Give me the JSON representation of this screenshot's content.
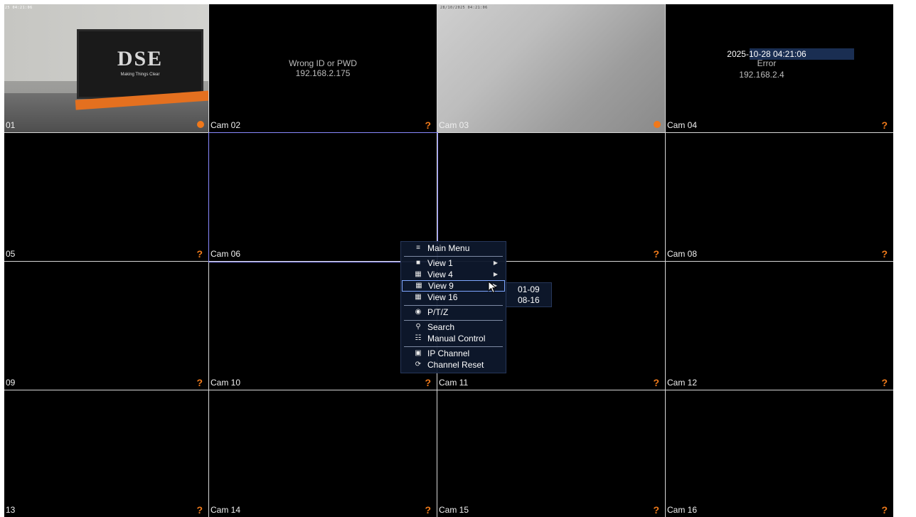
{
  "cells": [
    {
      "id": "c1",
      "label": "01",
      "status": "dot",
      "timestamp": "25 04:21:06"
    },
    {
      "id": "c2",
      "label": "Cam 02",
      "status": "?",
      "message": [
        "Wrong ID or PWD",
        "192.168.2.175"
      ]
    },
    {
      "id": "c3",
      "label": "Cam 03",
      "status": "dot",
      "timestamp": "28/10/2025 04:21:06"
    },
    {
      "id": "c4",
      "label": "Cam 04",
      "status": "?",
      "datetime": "2025-10-28 04:21:06",
      "message": [
        "Error",
        "192.168.2.4"
      ]
    },
    {
      "id": "c5",
      "label": "05",
      "status": "?"
    },
    {
      "id": "c6",
      "label": "Cam 06",
      "status": ""
    },
    {
      "id": "c7",
      "label": "",
      "status": "?"
    },
    {
      "id": "c8",
      "label": "Cam 08",
      "status": "?"
    },
    {
      "id": "c9",
      "label": "09",
      "status": "?"
    },
    {
      "id": "c10",
      "label": "Cam 10",
      "status": "?"
    },
    {
      "id": "c11",
      "label": "Cam 11",
      "status": "?"
    },
    {
      "id": "c12",
      "label": "Cam 12",
      "status": "?"
    },
    {
      "id": "c13",
      "label": "13",
      "status": "?"
    },
    {
      "id": "c14",
      "label": "Cam 14",
      "status": "?"
    },
    {
      "id": "c15",
      "label": "Cam 15",
      "status": "?"
    },
    {
      "id": "c16",
      "label": "Cam 16",
      "status": "?"
    }
  ],
  "cam1_scene": {
    "logo": "DSE",
    "tagline": "Making Things Clear"
  },
  "context_menu": {
    "items": [
      {
        "icon": "menu-icon",
        "glyph": "≡",
        "label": "Main Menu"
      },
      {
        "icon": "single-view-icon",
        "glyph": "■",
        "label": "View 1",
        "submenu": true
      },
      {
        "icon": "quad-view-icon",
        "glyph": "▦",
        "label": "View 4",
        "submenu": true
      },
      {
        "icon": "nine-view-icon",
        "glyph": "▦",
        "label": "View 9",
        "submenu": true,
        "highlighted": true
      },
      {
        "icon": "sixteen-view-icon",
        "glyph": "▦",
        "label": "View 16"
      },
      {
        "icon": "ptz-icon",
        "glyph": "◉",
        "label": "P/T/Z"
      },
      {
        "icon": "search-icon",
        "glyph": "⚲",
        "label": "Search"
      },
      {
        "icon": "manual-control-icon",
        "glyph": "☷",
        "label": "Manual Control"
      },
      {
        "icon": "ip-channel-icon",
        "glyph": "▣",
        "label": "IP Channel"
      },
      {
        "icon": "channel-reset-icon",
        "glyph": "⟳",
        "label": "Channel Reset"
      }
    ],
    "view9_submenu": [
      "01-09",
      "08-16"
    ]
  },
  "colors": {
    "alert": "#f07a1a",
    "menu_bg": "#0e182c",
    "highlight": "#7ea6ff"
  }
}
